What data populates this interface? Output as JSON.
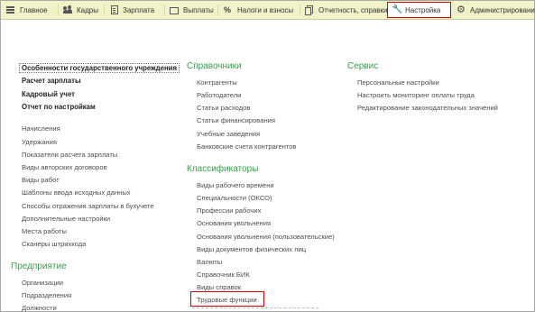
{
  "toolbar": {
    "items": [
      {
        "label": "Главное",
        "icon": "menu-icon"
      },
      {
        "label": "Кадры",
        "icon": "users-icon"
      },
      {
        "label": "Зарплата",
        "icon": "document-icon"
      },
      {
        "label": "Выплаты",
        "icon": "wallet-icon"
      },
      {
        "label": "Налоги и взносы",
        "icon": "percent-icon"
      },
      {
        "label": "Отчетность, справки",
        "icon": "reports-icon"
      },
      {
        "label": "Настройка",
        "icon": "wrench-icon",
        "active": true
      },
      {
        "label": "Администрирование",
        "icon": "gear-icon"
      }
    ]
  },
  "left": {
    "bold_items": [
      "Особенности государственного учреждения",
      "Расчет зарплаты",
      "Кадровый учет",
      "Отчет по настройкам"
    ],
    "items": [
      "Начисления",
      "Удержания",
      "Показатели расчета зарплаты",
      "Виды авторских договоров",
      "Виды работ",
      "Шаблоны ввода исходных данных",
      "Способы отражения зарплаты в бухучете",
      "Дополнительные настройки",
      "Места работы",
      "Сканеры штрихкода"
    ],
    "section_title": "Предприятие",
    "section_items": [
      "Организации",
      "Подразделения",
      "Должности"
    ]
  },
  "middle": {
    "refs_title": "Справочники",
    "refs": [
      "Контрагенты",
      "Работодатели",
      "Статьи расходов",
      "Статьи финансирования",
      "Учебные заведения",
      "Банковские счета контрагентов"
    ],
    "class_title": "Классификаторы",
    "classes": [
      "Виды рабочего времени",
      "Специальности (ОКСО)",
      "Профессии рабочих",
      "Основания увольнения",
      "Основания увольнения (пользовательские)",
      "Виды документов физических лиц",
      "Валюты",
      "Справочник БИК",
      "Виды справок",
      "Трудовые функции"
    ]
  },
  "right": {
    "title": "Сервис",
    "items": [
      "Персональные настройки",
      "Настроить мониторинг оплаты труда",
      "Редактирование законодательных значений"
    ]
  },
  "colors": {
    "toolbar_bg": "#f2f2c8",
    "section_heading": "#3d9b4d",
    "highlight": "#d40000"
  }
}
